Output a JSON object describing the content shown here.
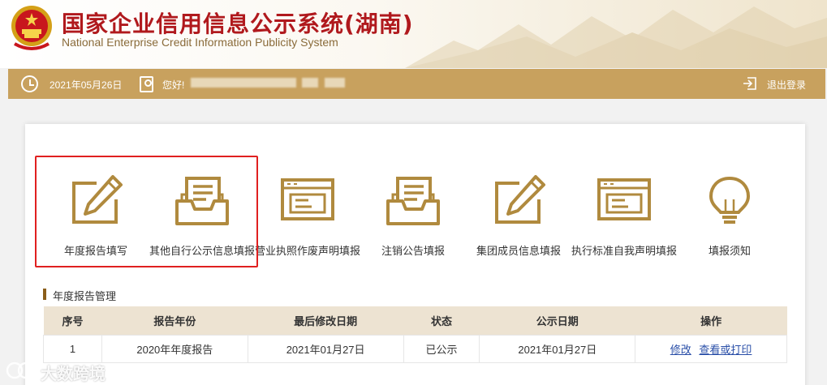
{
  "header": {
    "title_cn": "国家企业信用信息公示系统(湖南)",
    "title_en": "National Enterprise Credit Information Publicity System"
  },
  "topbar": {
    "date": "2021年05月26日",
    "greeting": "您好!",
    "logout": "退出登录"
  },
  "tiles": [
    {
      "label": "年度报告填写",
      "icon": "pencil-edit-icon"
    },
    {
      "label": "其他自行公示信息填报",
      "icon": "inbox-document-icon"
    },
    {
      "label": "营业执照作废声明填报",
      "icon": "certificate-icon"
    },
    {
      "label": "注销公告填报",
      "icon": "inbox-document-icon"
    },
    {
      "label": "集团成员信息填报",
      "icon": "pencil-edit-icon"
    },
    {
      "label": "执行标准自我声明填报",
      "icon": "certificate-icon"
    },
    {
      "label": "填报须知",
      "icon": "lightbulb-icon"
    }
  ],
  "section": {
    "title": "年度报告管理"
  },
  "table": {
    "headers": [
      "序号",
      "报告年份",
      "最后修改日期",
      "状态",
      "公示日期",
      "操作"
    ],
    "rows": [
      {
        "no": "1",
        "year": "2020年年度报告",
        "modified": "2021年01月27日",
        "status": "已公示",
        "publish": "2021年01月27日",
        "action_edit": "修改",
        "action_view": "查看或打印"
      }
    ]
  },
  "watermark": {
    "text": "大数跨境"
  },
  "colors": {
    "accent_gold": "#c8a15e",
    "icon_gold": "#b08a3e",
    "title_red": "#b0191d",
    "highlight_red": "#e02020",
    "link_blue": "#2a4fa8"
  }
}
